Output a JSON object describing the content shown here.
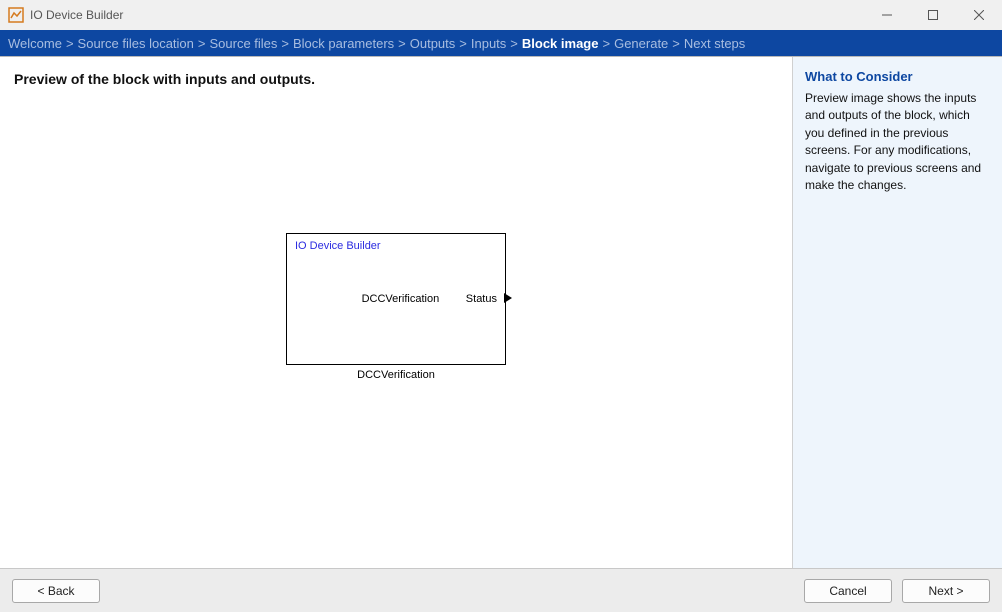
{
  "window": {
    "title": "IO Device Builder"
  },
  "breadcrumbs": {
    "items": [
      "Welcome",
      "Source files location",
      "Source files",
      "Block parameters",
      "Outputs",
      "Inputs",
      "Block image",
      "Generate",
      "Next steps"
    ],
    "current_index": 6,
    "separator": ">"
  },
  "main": {
    "heading": "Preview of the block with inputs and outputs.",
    "block": {
      "title": "IO Device Builder",
      "center_label": "DCCVerification",
      "output_port": "Status",
      "caption": "DCCVerification"
    }
  },
  "help": {
    "title": "What to Consider",
    "body": "Preview image shows the inputs and outputs of the block, which you defined in the previous screens. For any modifications, navigate to previous screens and make the changes."
  },
  "footer": {
    "back": "< Back",
    "cancel": "Cancel",
    "next": "Next >"
  }
}
